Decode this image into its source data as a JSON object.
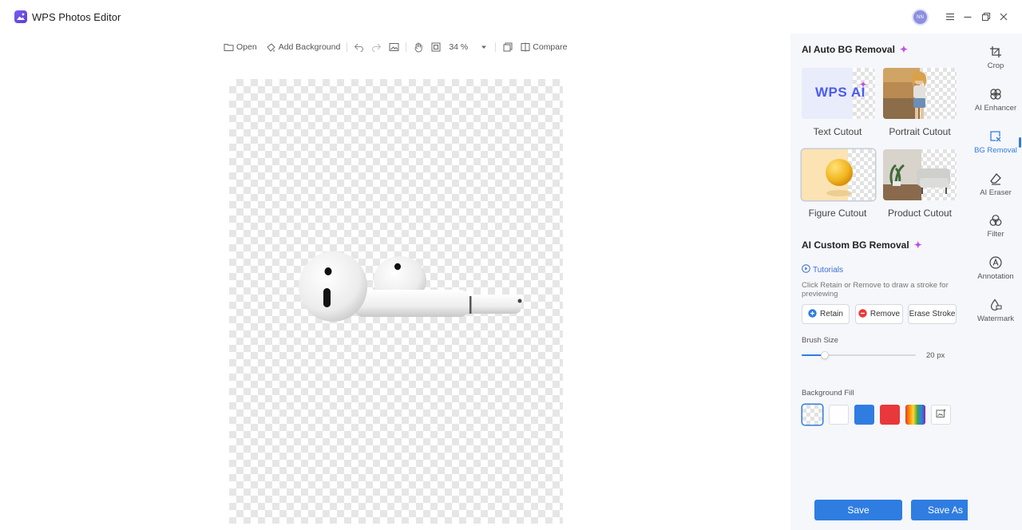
{
  "app": {
    "title": "WPS Photos Editor",
    "avatar_initials": "NN"
  },
  "toolbar": {
    "open": "Open",
    "add_background": "Add Background",
    "zoom": "34 %",
    "compare": "Compare"
  },
  "panel": {
    "auto_title": "AI Auto BG Removal",
    "wps_ai_text": "WPS AI",
    "cards": [
      "Text Cutout",
      "Portrait Cutout",
      "Figure Cutout",
      "Product Cutout"
    ],
    "custom_title": "AI Custom BG Removal",
    "tutorials": "Tutorials",
    "hint": "Click Retain or Remove to draw a stroke for previewing",
    "retain": "Retain",
    "remove": "Remove",
    "erase_stroke": "Erase Stroke",
    "brush_size_label": "Brush Size",
    "brush_size_value": "20 px",
    "brush_size_fraction": 0.2,
    "background_fill_label": "Background Fill",
    "fill_colors": [
      "#ffffff",
      "#2f7de1",
      "#e8383b"
    ],
    "save": "Save",
    "save_as": "Save As"
  },
  "rail": [
    {
      "label": "Crop",
      "icon": "crop-icon"
    },
    {
      "label": "AI Enhancer",
      "icon": "ai-enhancer-icon"
    },
    {
      "label": "BG Removal",
      "icon": "bg-removal-icon",
      "active": true
    },
    {
      "label": "AI Eraser",
      "icon": "eraser-icon"
    },
    {
      "label": "Filter",
      "icon": "filter-icon"
    },
    {
      "label": "Annotation",
      "icon": "annotation-icon"
    },
    {
      "label": "Watermark",
      "icon": "watermark-icon"
    }
  ],
  "colors": {
    "accent": "#2f7de1",
    "sparkle": "#c04fe6"
  }
}
